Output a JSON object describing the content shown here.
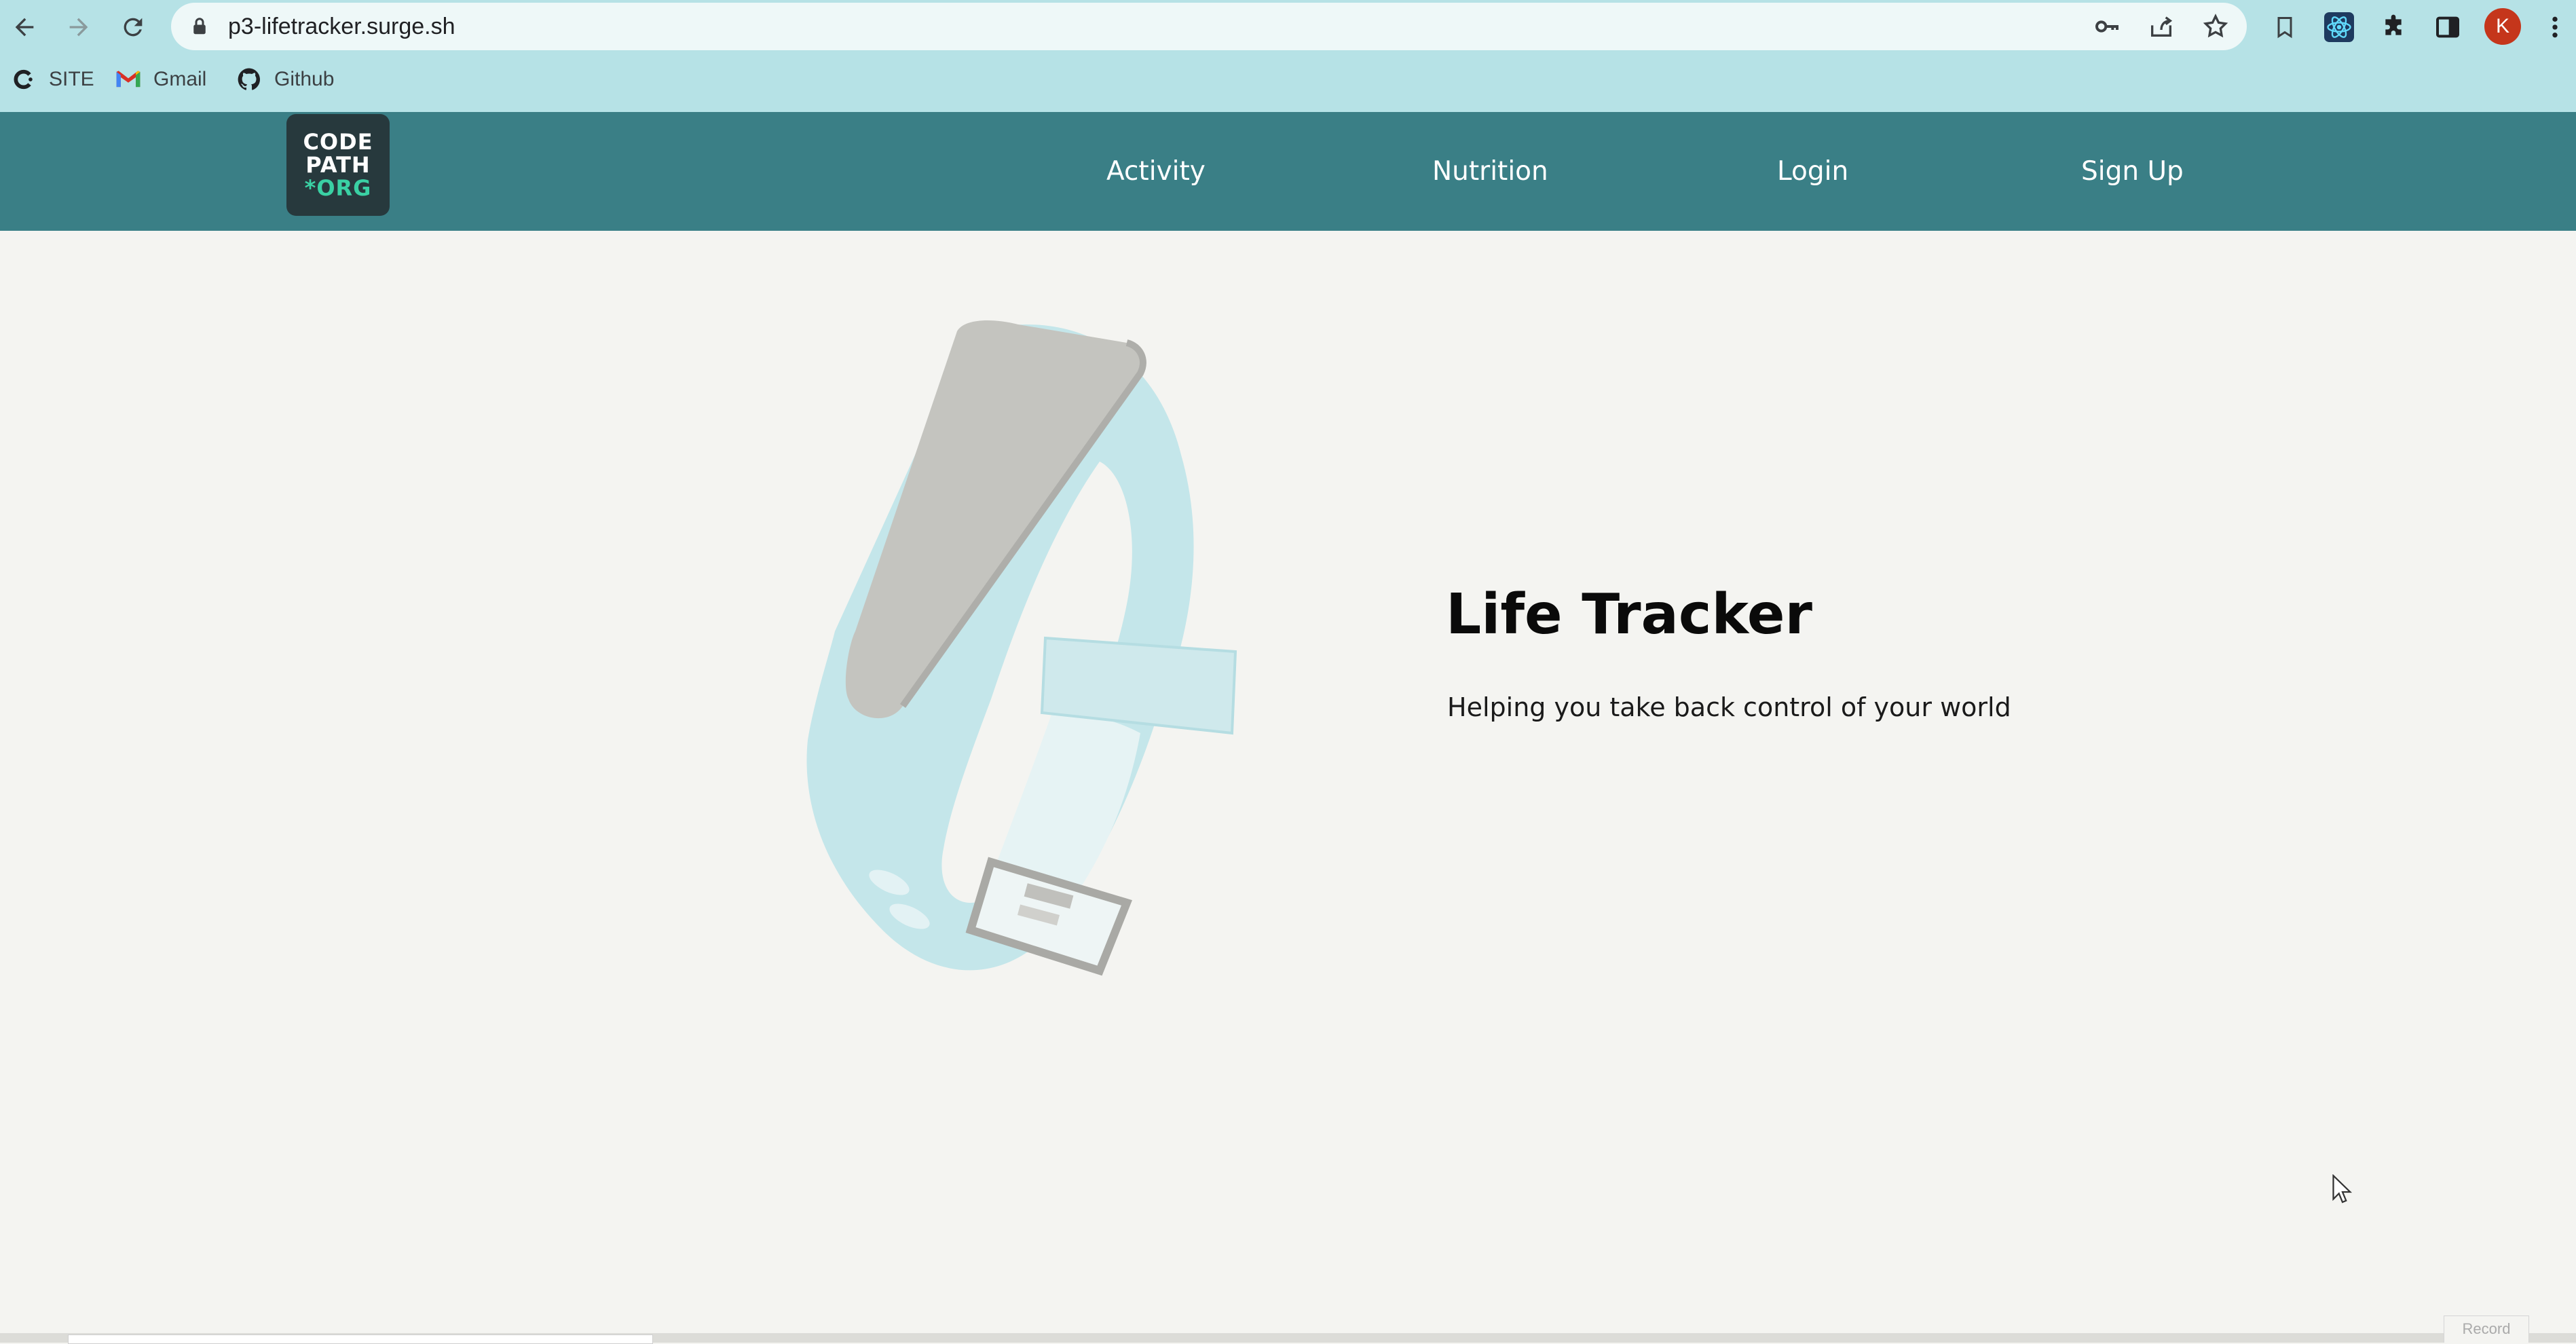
{
  "browser": {
    "url": "p3-lifetracker.surge.sh",
    "profile_initial": "K",
    "bookmarks": [
      {
        "label": "SITE",
        "icon": "codepath-favicon-icon"
      },
      {
        "label": "Gmail",
        "icon": "gmail-icon"
      },
      {
        "label": "Github",
        "icon": "github-icon"
      }
    ]
  },
  "navbar": {
    "logo_lines": [
      "CODE",
      "PATH",
      "*ORG"
    ],
    "links": [
      "Activity",
      "Nutrition",
      "Login",
      "Sign Up"
    ]
  },
  "hero": {
    "title": "Life Tracker",
    "tagline": "Helping you take back control of your world"
  },
  "overlay": {
    "record_label": "Record"
  },
  "colors": {
    "chrome_bg": "#b6e2e6",
    "navbar_bg": "#3a7f86",
    "page_bg": "#f4f4f1",
    "logo_bg": "#27393d",
    "logo_accent": "#3ad1a4",
    "avatar": "#c5361b"
  }
}
